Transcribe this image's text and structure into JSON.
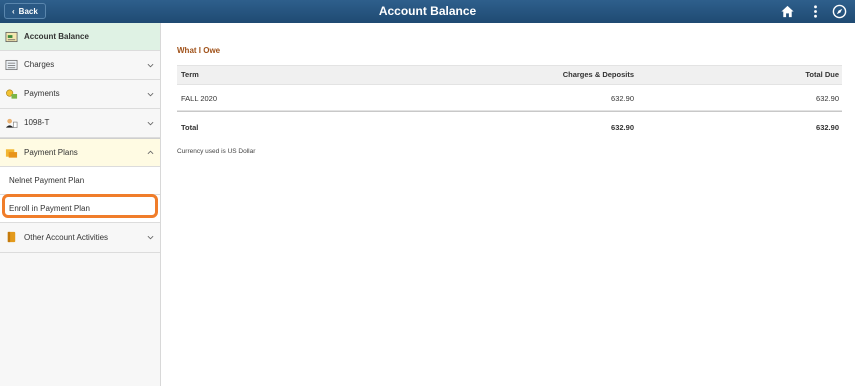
{
  "header": {
    "back_label": "Back",
    "title": "Account Balance",
    "icons": [
      "home-icon",
      "kebab-menu-icon",
      "compass-icon"
    ]
  },
  "sidebar": {
    "items": [
      {
        "label": "Account Balance",
        "icon": "account-balance-icon",
        "selected": true
      },
      {
        "label": "Charges",
        "icon": "charges-icon"
      },
      {
        "label": "Payments",
        "icon": "payments-icon"
      },
      {
        "label": "1098-T",
        "icon": "1098t-icon"
      },
      {
        "label": "Payment Plans",
        "icon": "payment-plans-icon",
        "expanded": true
      },
      {
        "label": "Other Account Activities",
        "icon": "other-activities-icon"
      }
    ],
    "sub_items": [
      {
        "label": "Nelnet Payment Plan"
      },
      {
        "label": "Enroll in Payment Plan"
      }
    ]
  },
  "main": {
    "section_title": "What I Owe",
    "table": {
      "columns": [
        "Term",
        "Charges & Deposits",
        "Total Due"
      ],
      "rows": [
        {
          "term": "FALL 2020",
          "charges": "632.90",
          "due": "632.90"
        }
      ],
      "total": {
        "label": "Total",
        "charges": "632.90",
        "due": "632.90"
      }
    },
    "currency_note": "Currency used is US Dollar"
  },
  "colors": {
    "header_bg": "#1f4a72",
    "selected_nav_bg": "#dff2e4",
    "expanded_nav_bg": "#fffbe3",
    "section_title": "#a0521a",
    "highlight": "#f07d2a"
  }
}
